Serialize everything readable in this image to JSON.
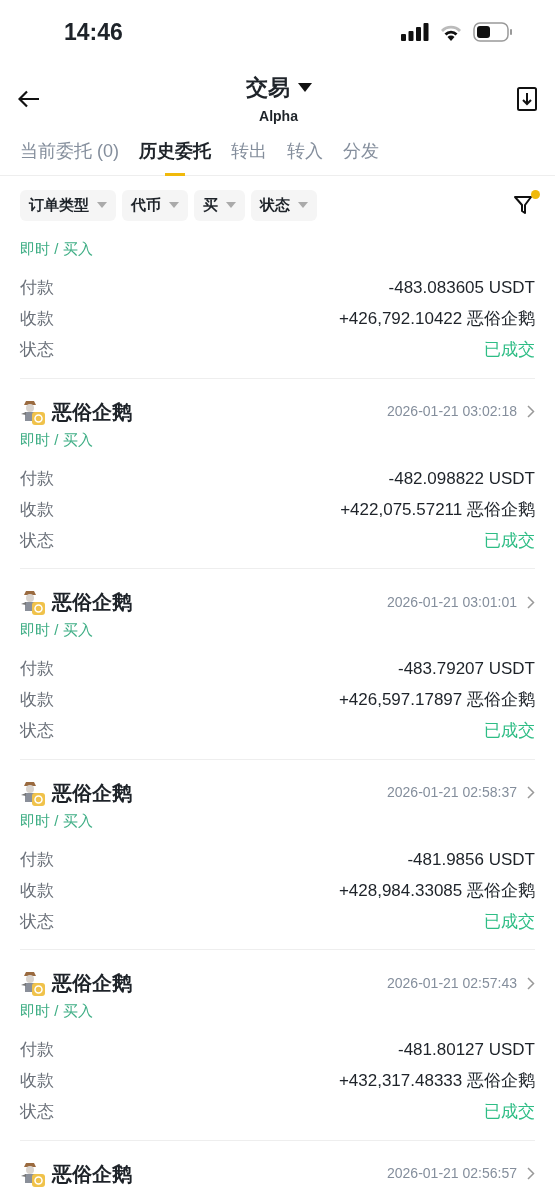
{
  "status_bar": {
    "time": "14:46"
  },
  "header": {
    "title": "交易",
    "subtitle": "Alpha"
  },
  "tabs": [
    {
      "label": "当前委托 (0)",
      "selected": false
    },
    {
      "label": "历史委托",
      "selected": true
    },
    {
      "label": "转出",
      "selected": false
    },
    {
      "label": "转入",
      "selected": false
    },
    {
      "label": "分发",
      "selected": false
    }
  ],
  "filters": [
    "订单类型",
    "代币",
    "买",
    "状态"
  ],
  "filter_active": true,
  "orders": [
    {
      "tag": "即时 / 买入",
      "rows": [
        {
          "label": "付款",
          "value": "-483.083605 USDT"
        },
        {
          "label": "收款",
          "value": "+426,792.10422 恶俗企鹅"
        },
        {
          "label": "状态",
          "value": "已成交",
          "kind": "status"
        }
      ]
    },
    {
      "name": "恶俗企鹅",
      "time": "2026-01-21 03:02:18",
      "tag": "即时 / 买入",
      "rows": [
        {
          "label": "付款",
          "value": "-482.098822 USDT"
        },
        {
          "label": "收款",
          "value": "+422,075.57211 恶俗企鹅"
        },
        {
          "label": "状态",
          "value": "已成交",
          "kind": "status"
        }
      ]
    },
    {
      "name": "恶俗企鹅",
      "time": "2026-01-21 03:01:01",
      "tag": "即时 / 买入",
      "rows": [
        {
          "label": "付款",
          "value": "-483.79207 USDT"
        },
        {
          "label": "收款",
          "value": "+426,597.17897 恶俗企鹅"
        },
        {
          "label": "状态",
          "value": "已成交",
          "kind": "status"
        }
      ]
    },
    {
      "name": "恶俗企鹅",
      "time": "2026-01-21 02:58:37",
      "tag": "即时 / 买入",
      "rows": [
        {
          "label": "付款",
          "value": "-481.9856 USDT"
        },
        {
          "label": "收款",
          "value": "+428,984.33085 恶俗企鹅"
        },
        {
          "label": "状态",
          "value": "已成交",
          "kind": "status"
        }
      ]
    },
    {
      "name": "恶俗企鹅",
      "time": "2026-01-21 02:57:43",
      "tag": "即时 / 买入",
      "rows": [
        {
          "label": "付款",
          "value": "-481.80127 USDT"
        },
        {
          "label": "收款",
          "value": "+432,317.48333 恶俗企鹅"
        },
        {
          "label": "状态",
          "value": "已成交",
          "kind": "status"
        }
      ]
    },
    {
      "name": "恶俗企鹅",
      "time": "2026-01-21 02:56:57"
    }
  ]
}
